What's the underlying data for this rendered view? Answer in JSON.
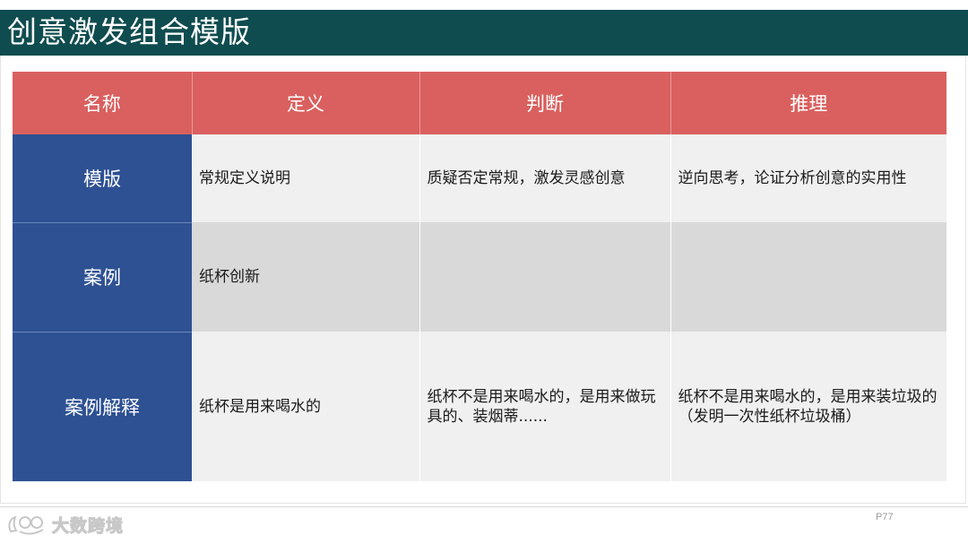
{
  "title": "创意激发组合模版",
  "table": {
    "headers": [
      "名称",
      "定义",
      "判断",
      "推理"
    ],
    "rows": [
      {
        "label": "模版",
        "cells": [
          "常规定义说明",
          "质疑否定常规，激发灵感创意",
          "逆向思考，论证分析创意的实用性"
        ]
      },
      {
        "label": "案例",
        "cells": [
          "纸杯创新",
          "",
          ""
        ]
      },
      {
        "label": "案例解释",
        "cells": [
          "纸杯是用来喝水的",
          "纸杯不是用来喝水的，是用来做玩具的、装烟蒂......",
          "纸杯不是用来喝水的，是用来装垃圾的（发明一次性纸杯垃圾桶）"
        ]
      }
    ]
  },
  "page_number": "P77",
  "watermark": {
    "text": "大数跨境",
    "icon": "brand-logo-icon"
  },
  "colors": {
    "title_bar": "#0f4c4f",
    "header_row": "#d9605f",
    "row_label": "#2e5193"
  }
}
